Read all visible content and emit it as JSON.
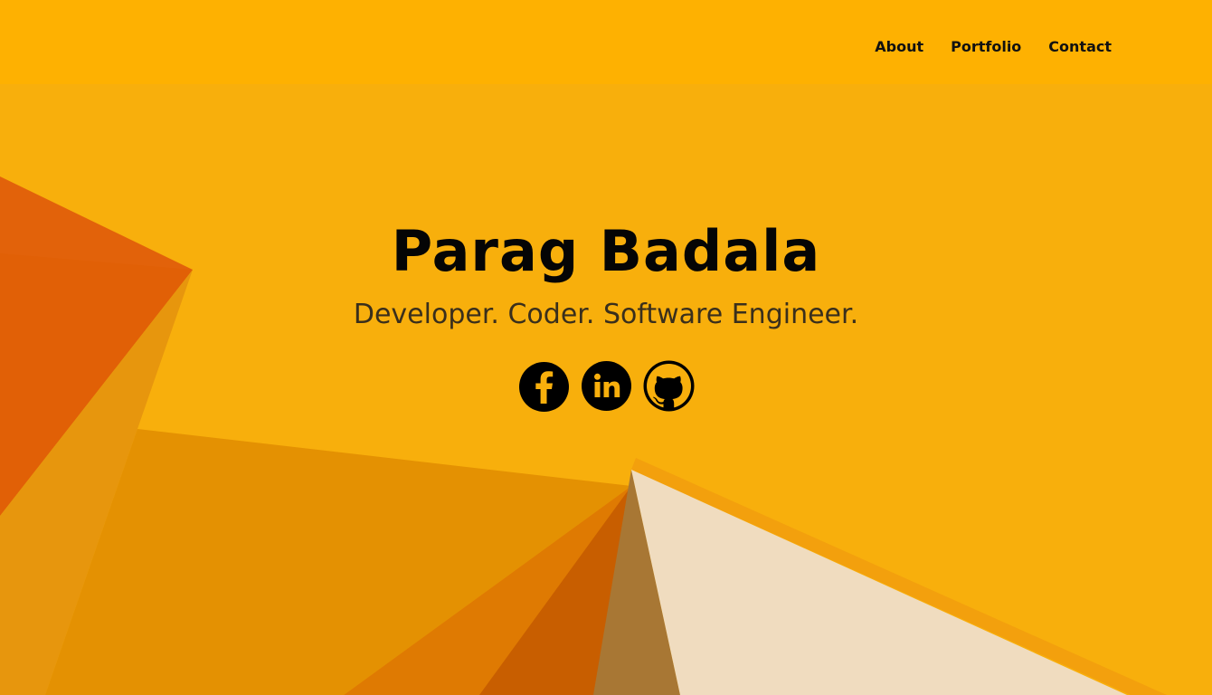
{
  "nav": {
    "items": [
      {
        "label": "About"
      },
      {
        "label": "Portfolio"
      },
      {
        "label": "Contact"
      }
    ]
  },
  "hero": {
    "name": "Parag Badala",
    "tagline": "Developer. Coder. Software Engineer."
  },
  "social": [
    {
      "icon": "facebook-icon"
    },
    {
      "icon": "linkedin-icon"
    },
    {
      "icon": "github-icon"
    }
  ],
  "colors": {
    "navbar": "#feb101",
    "background": "#f8af0c",
    "text": "#050505"
  }
}
